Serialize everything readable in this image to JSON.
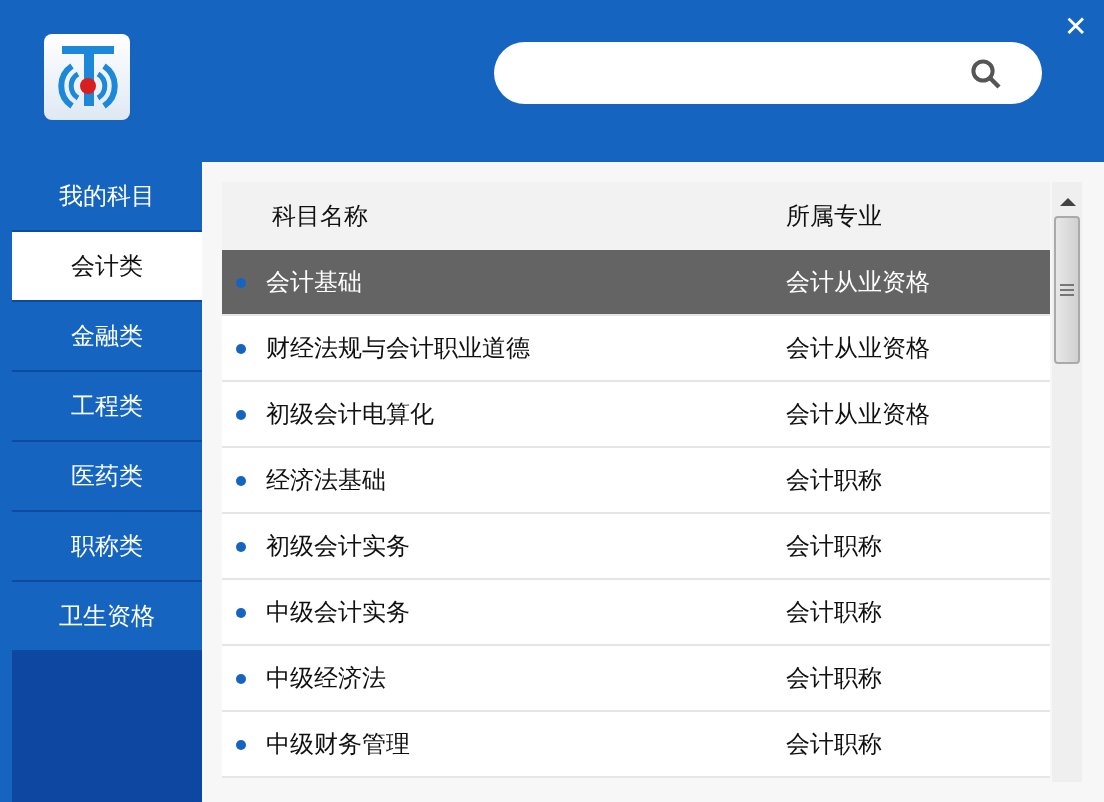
{
  "header": {
    "close": "✕"
  },
  "sidebar": {
    "items": [
      {
        "label": "我的科目",
        "selected": false
      },
      {
        "label": "会计类",
        "selected": true
      },
      {
        "label": "金融类",
        "selected": false
      },
      {
        "label": "工程类",
        "selected": false
      },
      {
        "label": "医药类",
        "selected": false
      },
      {
        "label": "职称类",
        "selected": false
      },
      {
        "label": "卫生资格",
        "selected": false
      }
    ]
  },
  "table": {
    "columns": [
      "科目名称",
      "所属专业"
    ],
    "rows": [
      {
        "name": "会计基础",
        "major": "会计从业资格",
        "selected": true
      },
      {
        "name": "财经法规与会计职业道德",
        "major": "会计从业资格",
        "selected": false
      },
      {
        "name": "初级会计电算化",
        "major": "会计从业资格",
        "selected": false
      },
      {
        "name": "经济法基础",
        "major": "会计职称",
        "selected": false
      },
      {
        "name": "初级会计实务",
        "major": "会计职称",
        "selected": false
      },
      {
        "name": "中级会计实务",
        "major": "会计职称",
        "selected": false
      },
      {
        "name": "中级经济法",
        "major": "会计职称",
        "selected": false
      },
      {
        "name": "中级财务管理",
        "major": "会计职称",
        "selected": false
      }
    ]
  }
}
